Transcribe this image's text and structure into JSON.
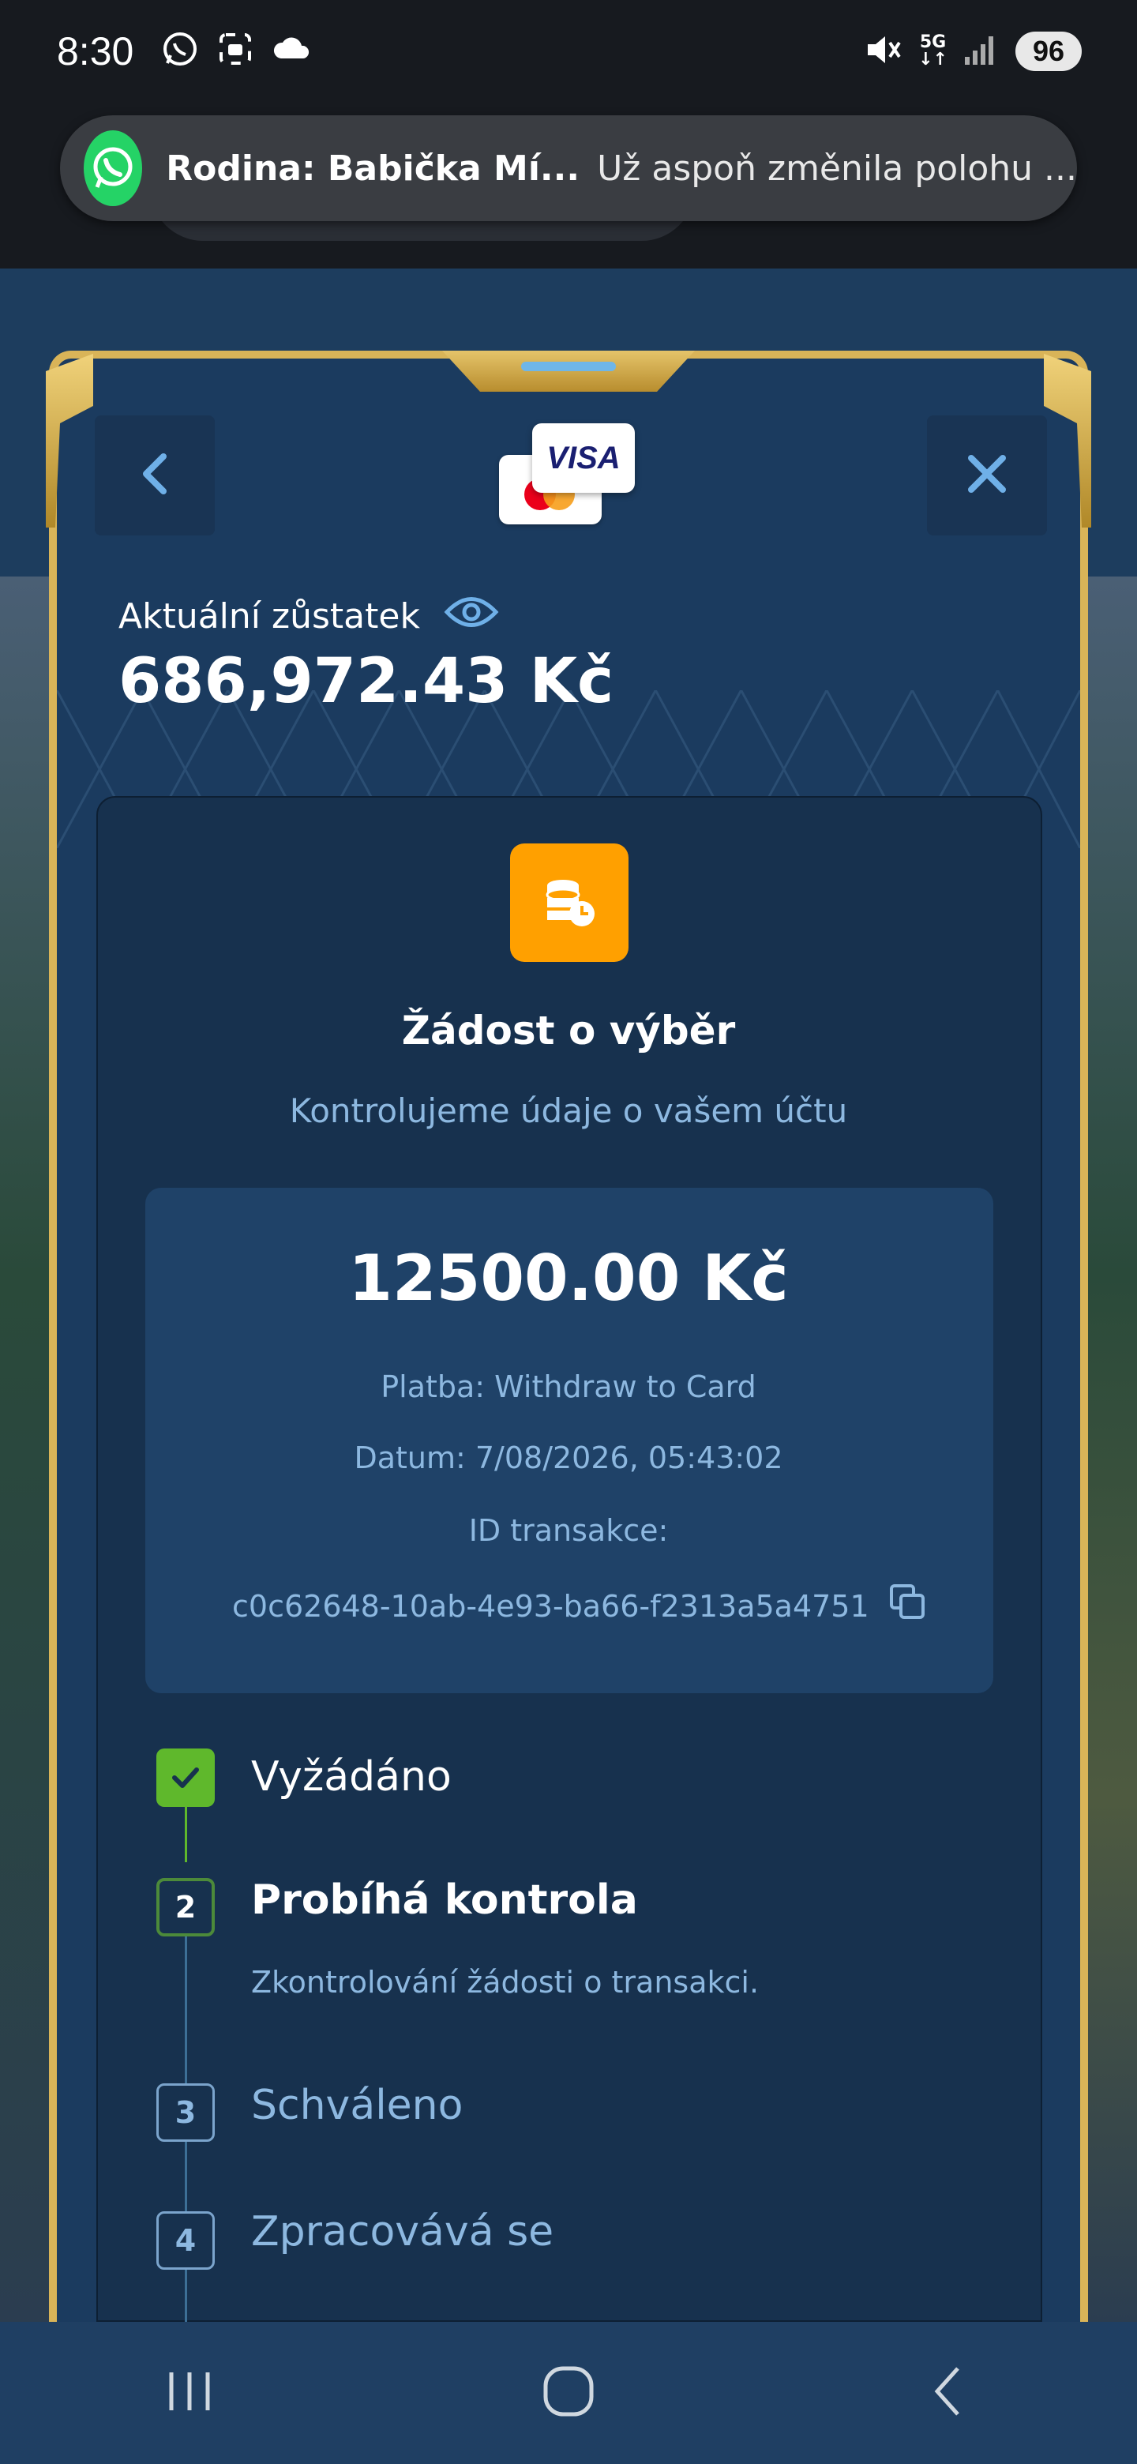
{
  "status_bar": {
    "time": "8:30",
    "battery": "96",
    "network": "5G",
    "icons_left": [
      "whatsapp-icon",
      "screenshot-icon",
      "cloud-icon"
    ],
    "icons_right": [
      "mute-icon",
      "network-icon",
      "signal-icon",
      "battery-icon"
    ]
  },
  "notification": {
    "app_icon": "whatsapp-icon",
    "title": "Rodina: Babička Mí...",
    "text": "Už aspoň změnila polohu ..."
  },
  "modal": {
    "back_icon": "chevron-left-icon",
    "close_icon": "close-icon",
    "card_logos": [
      "mastercard-icon",
      "visa-icon"
    ],
    "visa_label": "VISA",
    "balance_label": "Aktuální zůstatek",
    "balance_icon": "eye-icon",
    "balance_value": "686,972.43 Kč",
    "status_icon": "coins-clock-icon",
    "request_title": "Žádost o výběr",
    "request_subtitle": "Kontrolujeme údaje o vašem účtu",
    "amount": "12500.00 Kč",
    "payment": "Platba: Withdraw to Card",
    "date": "Datum: 7/08/2026, 05:43:02",
    "tx_label": "ID transakce:",
    "tx_id": "c0c62648-10ab-4e93-ba66-f2313a5a4751",
    "copy_icon": "copy-icon",
    "steps": [
      {
        "marker": "",
        "label": "Vyžádáno",
        "state": "done"
      },
      {
        "marker": "2",
        "label": "Probíhá kontrola",
        "state": "active",
        "description": "Zkontrolování žádosti o transakci."
      },
      {
        "marker": "3",
        "label": "Schváleno",
        "state": "todo"
      },
      {
        "marker": "4",
        "label": "Zpracovává se",
        "state": "todo"
      }
    ]
  },
  "nav_bar": {
    "items": [
      "recents-icon",
      "home-icon",
      "back-icon"
    ]
  },
  "colors": {
    "modal_bg": "#1b3b5f",
    "gold_frame": "#d9b458",
    "accent_orange": "#ffa000",
    "done_green": "#5fb82c",
    "muted_blue": "#8db8e0"
  }
}
